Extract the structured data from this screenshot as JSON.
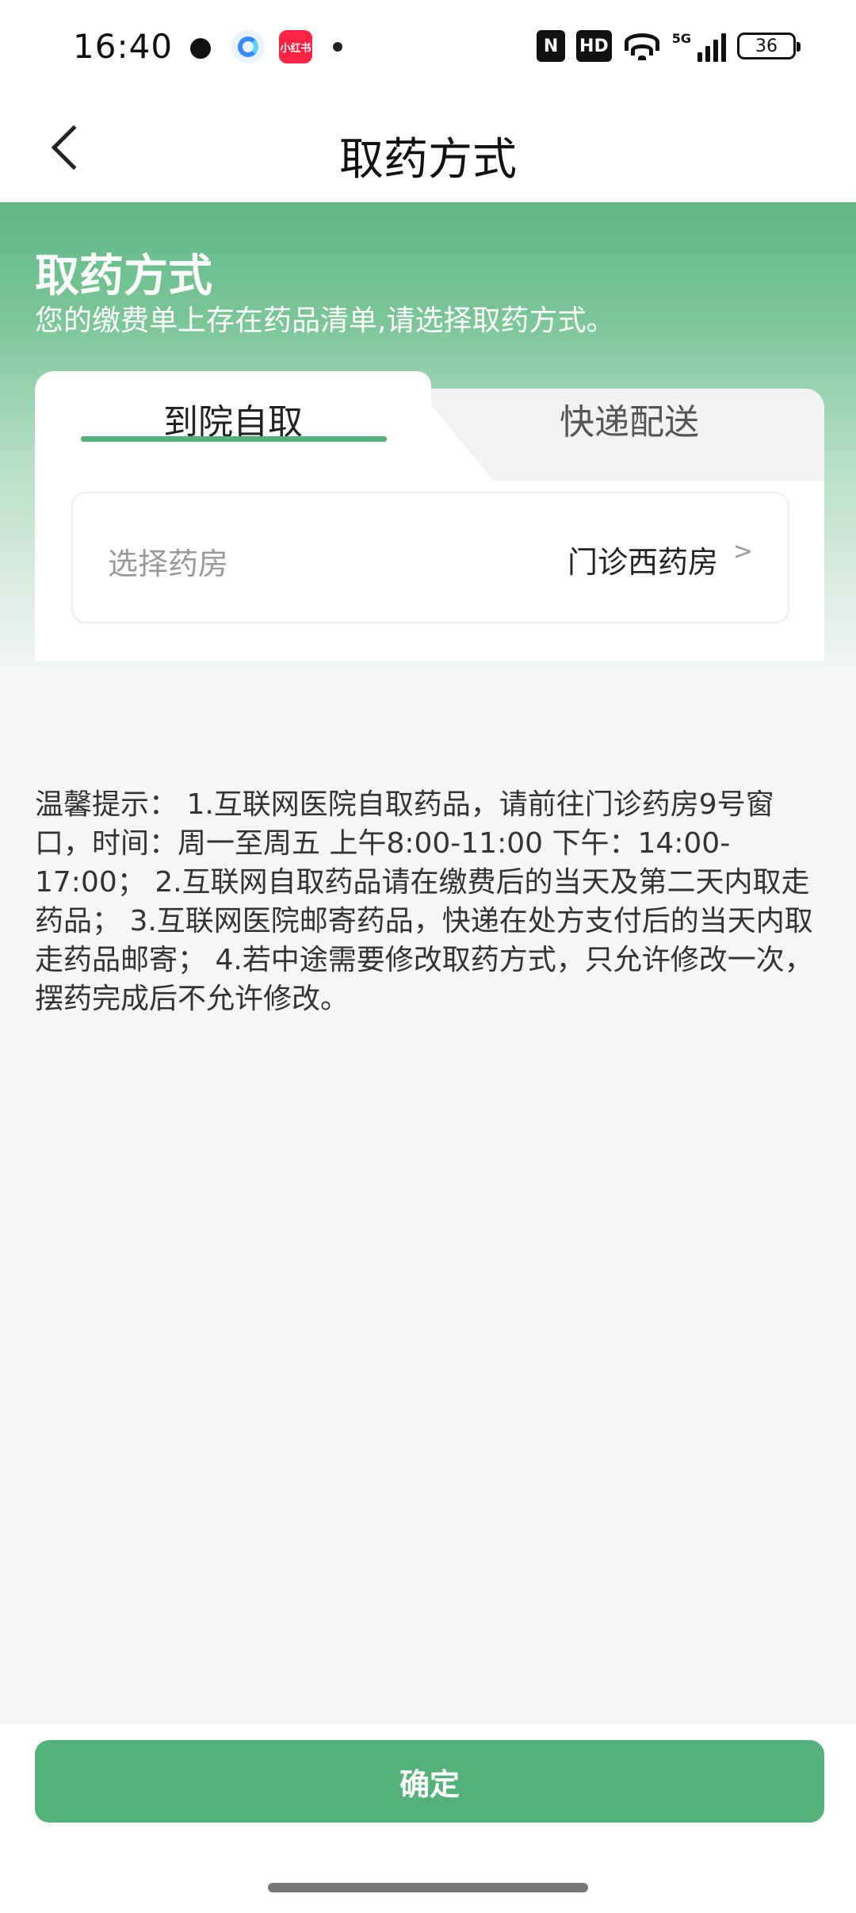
{
  "status_bar": {
    "time": "16:40",
    "xhs_badge": "小红书",
    "battery": "36",
    "network": "5G",
    "hd": "HD",
    "nfc": "N"
  },
  "nav": {
    "title": "取药方式"
  },
  "hero": {
    "title": "取药方式",
    "subtitle": "您的缴费单上存在药品清单,请选择取药方式。"
  },
  "tabs": [
    {
      "label": "到院自取",
      "active": true
    },
    {
      "label": "快递配送",
      "active": false
    }
  ],
  "pharmacy": {
    "label": "选择药房",
    "value": "门诊西药房",
    "arrow": ">"
  },
  "tips": "温馨提示： 1.互联网医院自取药品，请前往门诊药房9号窗口，时间：周一至周五 上午8:00-11:00 下午：14:00-17:00； 2.互联网自取药品请在缴费后的当天及第二天内取走药品； 3.互联网医院邮寄药品，快递在处方支付后的当天内取走药品邮寄； 4.若中途需要修改取药方式，只允许修改一次，摆药完成后不允许修改。",
  "confirm_label": "确定",
  "colors": {
    "brand_green": "#55b179",
    "header_green": "#5fb882"
  }
}
